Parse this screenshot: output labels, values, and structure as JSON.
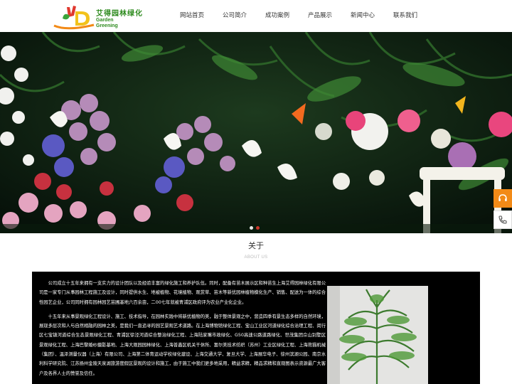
{
  "logo": {
    "name_cn": "艾得园林绿化",
    "name_en_line1": "Garden",
    "name_en_line2": "Greening"
  },
  "nav": {
    "items": [
      {
        "label": "网站首页"
      },
      {
        "label": "公司简介"
      },
      {
        "label": "成功案例"
      },
      {
        "label": "产品展示"
      },
      {
        "label": "新闻中心"
      },
      {
        "label": "联系我们"
      }
    ]
  },
  "banner": {
    "slide_count": 2,
    "active_slide": 2
  },
  "about": {
    "title": "关于",
    "subtitle": "ABOUT US",
    "paragraphs": [
      "公司成立十五年来拥有一支实力的设计团队以及经验丰富的绿化施工和养护队伍。同时，配备有苗木展示区和种苗生上海艾得园林绿化有限公司是一家专门从事园林工程施工及设计，同时提供水生、地被植物、花境植物、观赏草、苗木等新优园林植物模化生产、销售、配送为一体的综合性园艺企业，公司同时拥有园林园艺苗圃基地六百余亩，二00七年就被青浦区政府评为农业产业化企业。",
      "十五年来从事景观绿化工程设计、施工、技术指导，在园林实践中将新优植物的美，融于整体景观之中，营造四季有景生态多样的自然环境，展现多层次和人与自然相融的园林之美，是我们一直追寻的园艺景观艺术道路。在上海博物馆绿化工程、宝山工业区河道绿化综合治理工程、闵行区七宝镇河道综合生态景观绿化工程、青浦区徐泾河道综合整治绿化工程、上海陆家嘴市政绿化、G50高速公路道路绿化、世茂集团佘山别墅区景观绿化工程、上海巴黎婚纱摄影基地、上海大观园园林绿化、上海普鑫区机关干休所、富尔美技术纺织（苏州）工业区绿化工程、上海熊猫机械（集团）、温泽测量仪器（上海）有限公司、上海第二体育运动学校绿化建设、上海交通大学、复旦大学、上海展华电子、徐州滨湖公园、南京水利科学研究院、江苏扬州金陵天泉湖旅游度假区景观的设计和施工，由于施工中我们更多地采用，精益求精，精品求精和直观图表示资源最广大客户及各界人士的赞誉及信任。"
    ]
  },
  "side": {
    "icons": [
      "headset-icon",
      "phone-icon"
    ]
  },
  "colors": {
    "brand_green": "#2e8b1e",
    "accent_orange": "#f28a17",
    "dot_active": "#e0382e"
  }
}
